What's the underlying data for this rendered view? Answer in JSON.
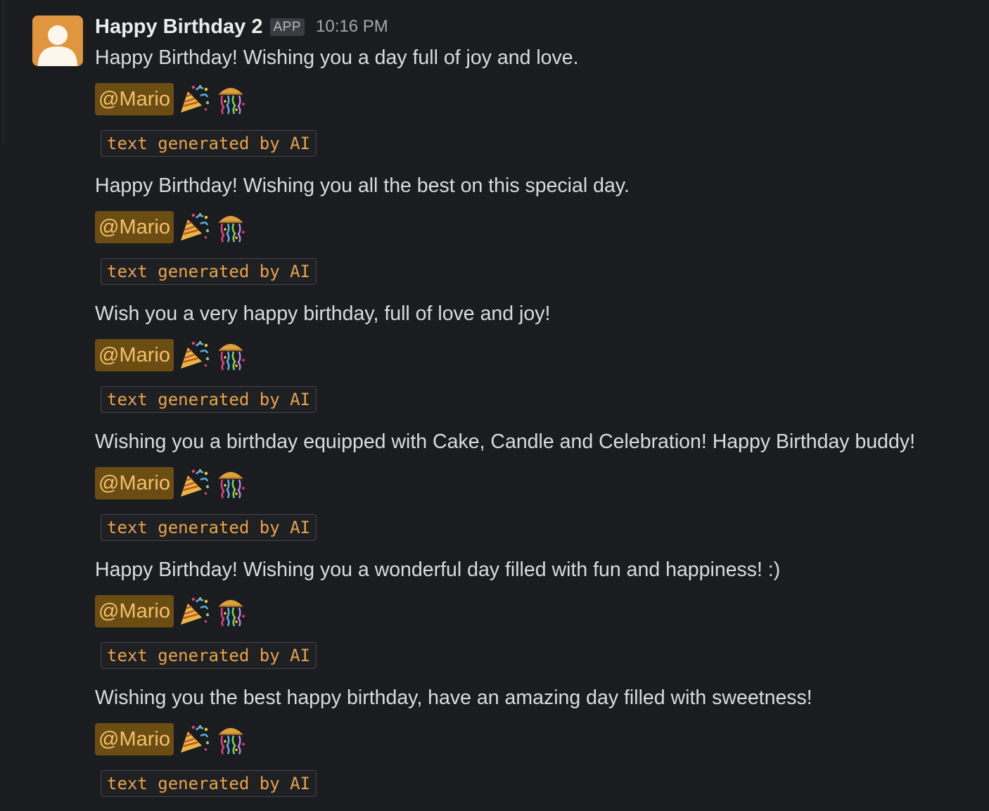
{
  "message": {
    "sender": "Happy Birthday 2",
    "badge": "APP",
    "time": "10:16 PM",
    "avatar_icon": "user-silhouette-icon",
    "avatar_color": "#e0953f"
  },
  "mention_color": "#f0c36a",
  "mention_bg": "#6b4c12",
  "code_color": "#e8a24a",
  "emojis": [
    "party-popper-icon",
    "confetti-ball-icon"
  ],
  "entries": [
    {
      "text": "Happy Birthday! Wishing you a day full of joy and love.",
      "mention": "@Mario",
      "tag": "text generated by AI"
    },
    {
      "text": "Happy Birthday! Wishing you all the best on this special day.",
      "mention": "@Mario",
      "tag": "text generated by AI"
    },
    {
      "text": "Wish you a very happy birthday, full of love and joy!",
      "mention": "@Mario",
      "tag": "text generated by AI"
    },
    {
      "text": "Wishing you a birthday equipped with Cake, Candle and Celebration! Happy Birthday buddy!",
      "mention": "@Mario",
      "tag": "text generated by AI"
    },
    {
      "text": "Happy Birthday! Wishing you a wonderful day filled with fun and happiness! :)",
      "mention": "@Mario",
      "tag": "text generated by AI"
    },
    {
      "text": "Wishing you the best happy birthday, have an amazing day filled with sweetness!",
      "mention": "@Mario",
      "tag": "text generated by AI"
    }
  ]
}
